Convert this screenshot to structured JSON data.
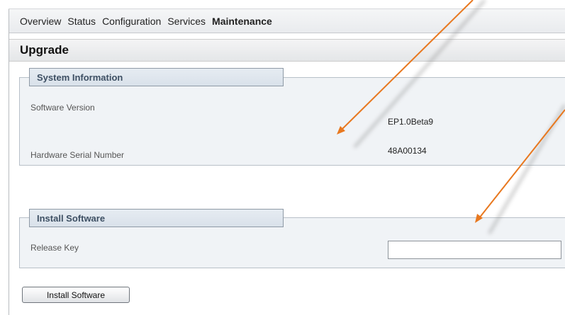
{
  "nav": {
    "items": [
      {
        "label": "Overview"
      },
      {
        "label": "Status"
      },
      {
        "label": "Configuration"
      },
      {
        "label": "Services"
      },
      {
        "label": "Maintenance"
      }
    ],
    "active": "Maintenance"
  },
  "page": {
    "title": "Upgrade"
  },
  "system_info": {
    "legend": "System Information",
    "software_version_label": "Software Version",
    "software_version_value": "EP1.0Beta9",
    "serial_label": "Hardware Serial Number",
    "serial_value": "48A00134"
  },
  "install": {
    "legend": "Install Software",
    "release_key_label": "Release Key",
    "release_key_value": "",
    "button_label": "Install Software"
  },
  "annotation": {
    "arrow_color": "#e8781f"
  }
}
